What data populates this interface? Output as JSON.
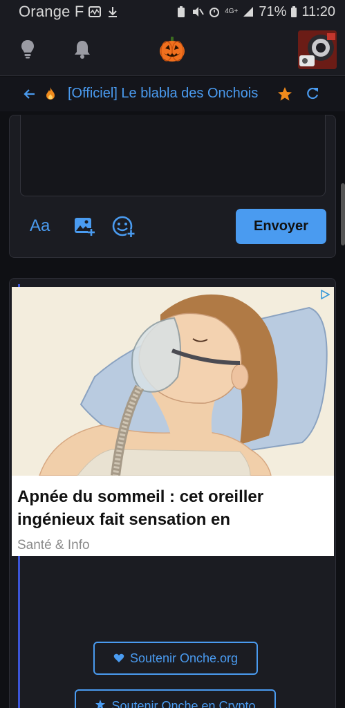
{
  "status_bar": {
    "carrier": "Orange F",
    "battery": "71%",
    "network": "4G+",
    "time": "11:20"
  },
  "top_nav": {
    "icons": [
      "lightbulb-icon",
      "bell-icon",
      "pumpkin-logo",
      "avatar"
    ]
  },
  "topic": {
    "title": "[Officiel] Le blabla des Onchois",
    "accent": "#4a9bf0",
    "star_color": "#f08a1c"
  },
  "composer": {
    "text_value": "",
    "format_label": "Aa",
    "send_label": "Envoyer"
  },
  "ad": {
    "headline": "Apnée du sommeil : cet oreiller ingénieux fait sensation en",
    "source": "Santé & Info"
  },
  "footer": {
    "support_label": "Soutenir Onche.org",
    "crypto_label": "Soutenir Onche en Crypto"
  }
}
